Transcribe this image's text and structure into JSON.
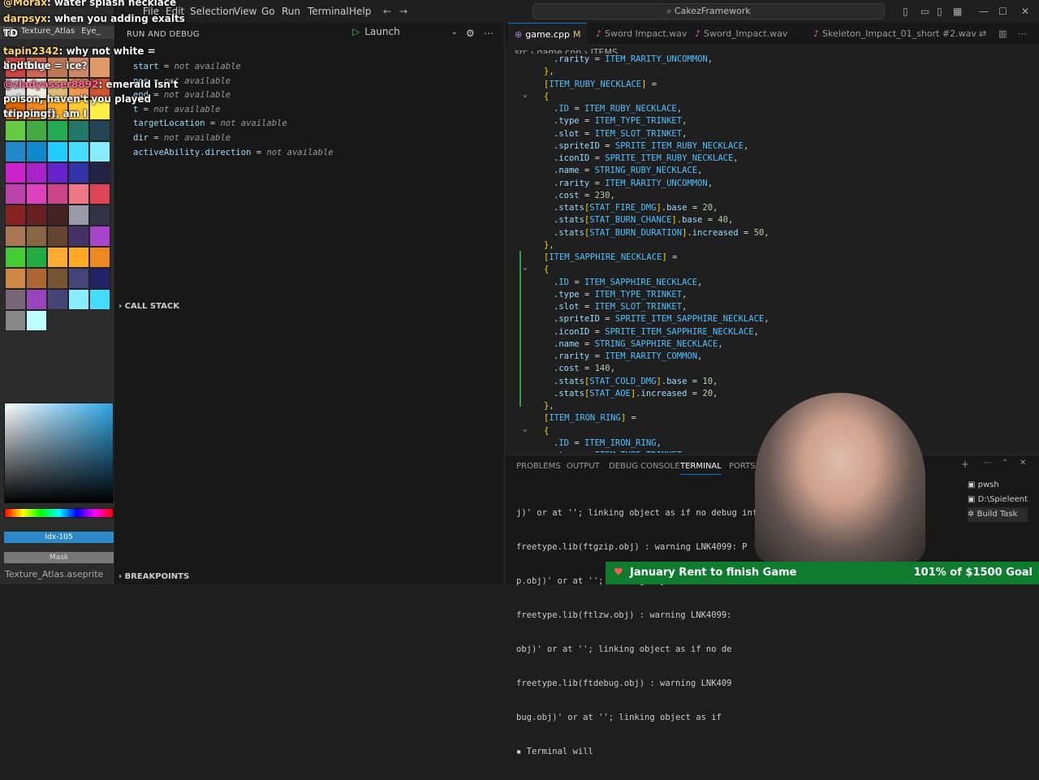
{
  "aseprite": {
    "tabs": [
      "TD",
      "Texture_Atlas",
      "Eye_"
    ],
    "idx_label": "Idx-105",
    "mask_label": "Mask",
    "filename": "Texture_Atlas.aseprite"
  },
  "chat": [
    {
      "user": "@Morax",
      "text": ": water splash necklace"
    },
    {
      "user": "darpsyx",
      "text": ": when you adding exalts to"
    },
    {
      "user": "",
      "text": "TD"
    },
    {
      "user": "tapin2342",
      "text": ": why not white = lighting"
    },
    {
      "user": "",
      "text": "and blue = ice?"
    },
    {
      "user": "@zladyasser8892",
      "text": ": emerald isn't"
    },
    {
      "user": "",
      "text": "poison, haven't you played Minecraft, am I"
    },
    {
      "user": "",
      "text": "tripping:)"
    }
  ],
  "titlebar": {
    "menu": [
      "File",
      "Edit",
      "Selection",
      "View",
      "Go",
      "Run",
      "Terminal",
      "Help"
    ],
    "search": "CakezFramework"
  },
  "debug": {
    "header": "RUN AND DEBUG",
    "launch": "Launch",
    "variables": [
      {
        "name": "start",
        "value": "not available"
      },
      {
        "name": "pos",
        "value": "not available"
      },
      {
        "name": "end",
        "value": "not available"
      },
      {
        "name": "t",
        "value": "not available"
      },
      {
        "name": "targetLocation",
        "value": "not available"
      },
      {
        "name": "dir",
        "value": "not available"
      },
      {
        "name": "activeAbility.direction",
        "value": "not available"
      }
    ],
    "call_stack": "CALL STACK",
    "breakpoints": "BREAKPOINTS"
  },
  "tabs": [
    {
      "label": "game.cpp",
      "modified": "M"
    },
    {
      "label": "Sword Impact.wav"
    },
    {
      "label": "Sword_Impact.wav"
    },
    {
      "label": "Skeleton_Impact_01_short #2.wav"
    }
  ],
  "breadcrumb": [
    "src",
    "game.cpp",
    "ITEMS"
  ],
  "code": [
    {
      "indent": 1,
      "text": ".rarity = ITEM_RARITY_UNCOMMON,"
    },
    {
      "indent": 0,
      "text": "},"
    },
    {
      "indent": 0,
      "text": "[ITEM_RUBY_NECKLACE] ="
    },
    {
      "indent": 0,
      "text": "{",
      "fold": true
    },
    {
      "indent": 1,
      "text": ".ID = ITEM_RUBY_NECKLACE,"
    },
    {
      "indent": 1,
      "text": ".type = ITEM_TYPE_TRINKET,"
    },
    {
      "indent": 1,
      "text": ".slot = ITEM_SLOT_TRINKET,"
    },
    {
      "indent": 1,
      "text": ".spriteID = SPRITE_ITEM_RUBY_NECKLACE,"
    },
    {
      "indent": 1,
      "text": ".iconID = SPRITE_ITEM_RUBY_NECKLACE,"
    },
    {
      "indent": 1,
      "text": ".name = STRING_RUBY_NECKLACE,"
    },
    {
      "indent": 1,
      "text": ".rarity = ITEM_RARITY_UNCOMMON,"
    },
    {
      "indent": 1,
      "text": ".cost = 230,"
    },
    {
      "indent": 1,
      "text": ".stats[STAT_FIRE_DMG].base = 20,"
    },
    {
      "indent": 1,
      "text": ".stats[STAT_BURN_CHANCE].base = 40,"
    },
    {
      "indent": 1,
      "text": ".stats[STAT_BURN_DURATION].increased = 50,"
    },
    {
      "indent": 0,
      "text": "},"
    },
    {
      "indent": 0,
      "text": "[ITEM_SAPPHIRE_NECKLACE] ="
    },
    {
      "indent": 0,
      "text": "{",
      "fold": true
    },
    {
      "indent": 1,
      "text": ".ID = ITEM_SAPPHIRE_NECKLACE,"
    },
    {
      "indent": 1,
      "text": ".type = ITEM_TYPE_TRINKET,"
    },
    {
      "indent": 1,
      "text": ".slot = ITEM_SLOT_TRINKET,"
    },
    {
      "indent": 1,
      "text": ".spriteID = SPRITE_ITEM_SAPPHIRE_NECKLACE,"
    },
    {
      "indent": 1,
      "text": ".iconID = SPRITE_ITEM_SAPPHIRE_NECKLACE,"
    },
    {
      "indent": 1,
      "text": ".name = STRING_SAPPHIRE_NECKLACE,"
    },
    {
      "indent": 1,
      "text": ".rarity = ITEM_RARITY_COMMON,"
    },
    {
      "indent": 1,
      "text": ".cost = 140,"
    },
    {
      "indent": 1,
      "text": ".stats[STAT_COLD_DMG].base = 10,"
    },
    {
      "indent": 1,
      "text": ".stats[STAT_AOE].increased = 20,"
    },
    {
      "indent": 0,
      "text": "},"
    },
    {
      "indent": 0,
      "text": "[ITEM_IRON_RING] ="
    },
    {
      "indent": 0,
      "text": "{",
      "fold": true
    },
    {
      "indent": 1,
      "text": ".ID = ITEM_IRON_RING,"
    },
    {
      "indent": 1,
      "text": ".type = ITEM_TYPE_TRINKET,"
    }
  ],
  "panel": {
    "tabs": [
      "PROBLEMS",
      "OUTPUT",
      "DEBUG CONSOLE",
      "TERMINAL",
      "PORTS"
    ],
    "active_tab": "TERMINAL",
    "terminal_lines": [
      "j)' or at ''; linking object as if no debug inf",
      "freetype.lib(ftgzip.obj) : warning LNK4099: P",
      "p.obj)' or at ''; linking object as if no d",
      "freetype.lib(ftlzw.obj) : warning LNK4099:",
      "obj)' or at ''; linking object as if no de",
      "freetype.lib(ftdebug.obj) : warning LNK409",
      "bug.obj)' or at ''; linking object as if",
      "Terminal will"
    ],
    "terminals": [
      "pwsh",
      "D:\\Spieleent",
      "Build Task"
    ]
  },
  "goal": {
    "label": "January Rent to finish Game",
    "amount": "101% of $1500 Goal"
  }
}
